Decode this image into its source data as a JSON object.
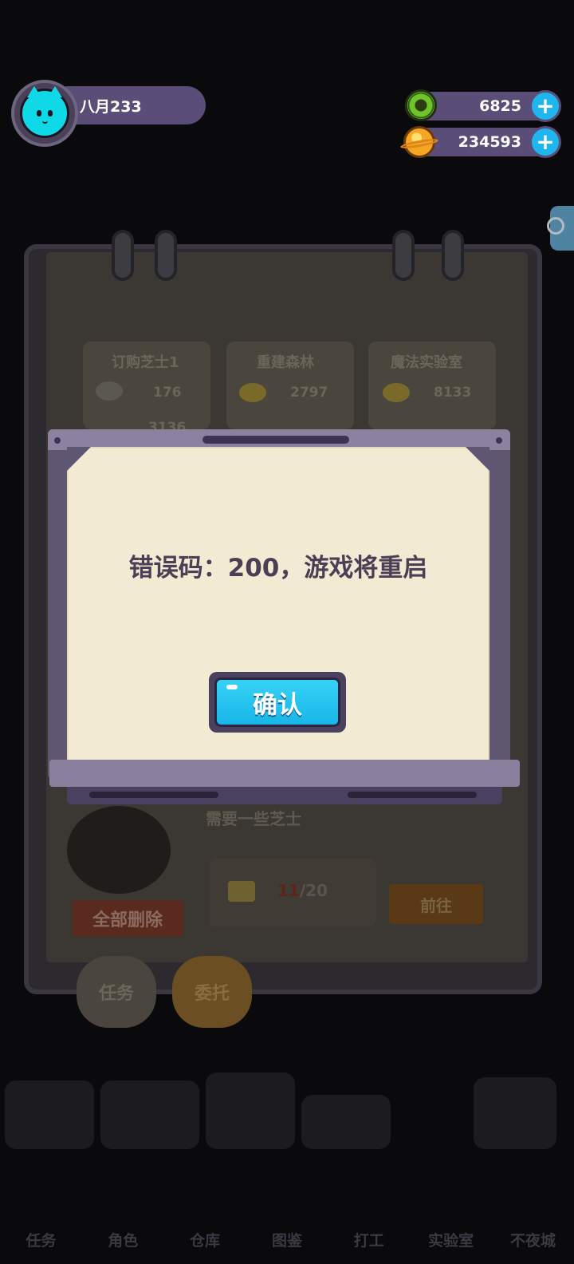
{
  "player": {
    "name": "八月233"
  },
  "currency": {
    "gems": "6825",
    "coins": "234593"
  },
  "background": {
    "cards": [
      {
        "title": "订购芝士1",
        "value": "176",
        "sub_value": "3136"
      },
      {
        "title": "重建森林",
        "value": "2797"
      },
      {
        "title": "魔法实验室",
        "value": "8133"
      }
    ],
    "task_text": "需要一些芝士",
    "progress_current": "11",
    "progress_total": "/20",
    "delete_all_label": "全部删除",
    "goto_label": "前往",
    "tabs": [
      "任务",
      "委托"
    ],
    "bottom_nav": [
      "任务",
      "角色",
      "仓库",
      "图鉴",
      "打工",
      "实验室",
      "不夜城"
    ]
  },
  "dialog": {
    "message": "错误码：200，游戏将重启",
    "confirm_label": "确认"
  }
}
